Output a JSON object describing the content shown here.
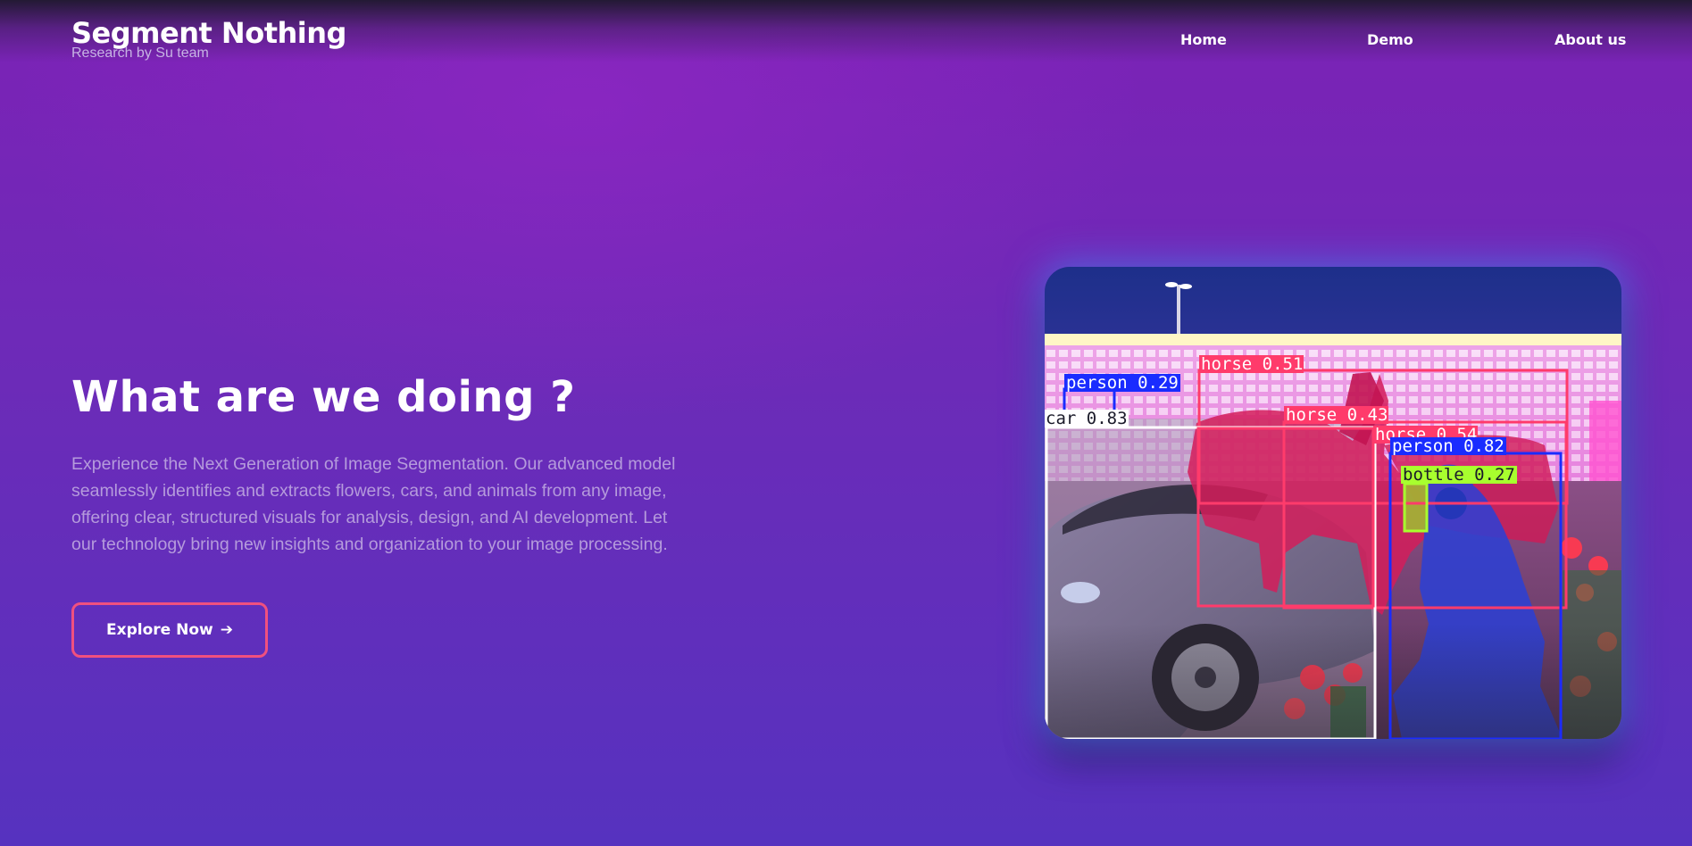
{
  "brand": {
    "title": "Segment Nothing",
    "subtitle": "Research by Su team"
  },
  "nav": {
    "items": [
      "Home",
      "Demo",
      "About us"
    ]
  },
  "hero": {
    "title": "What are we doing ?",
    "description": "Experience the Next Generation of Image Segmentation. Our advanced model seamlessly identifies and extracts flowers, cars, and animals from any image, offering clear, structured visuals for analysis, design, and AI development. Let our technology bring new insights and organization to your image processing.",
    "cta_label": "Explore Now",
    "cta_icon": "arrow-right-icon"
  },
  "demo_image": {
    "detections": [
      {
        "label": "horse 0.51",
        "color": "#ff3b6b"
      },
      {
        "label": "person 0.29",
        "color": "#1a2cff"
      },
      {
        "label": "horse 0.43",
        "color": "#ff3b6b"
      },
      {
        "label": "car 0.83",
        "color": "#ffffff"
      },
      {
        "label": "horse 0.54",
        "color": "#ff3b6b"
      },
      {
        "label": "person 0.82",
        "color": "#1a2cff"
      },
      {
        "label": "bottle 0.27",
        "color": "#a8ff2e"
      }
    ]
  },
  "colors": {
    "accent": "#f0507f",
    "background_top": "#7c22b6",
    "background_bottom": "#5632bf",
    "description_text": "#b59bdc"
  }
}
